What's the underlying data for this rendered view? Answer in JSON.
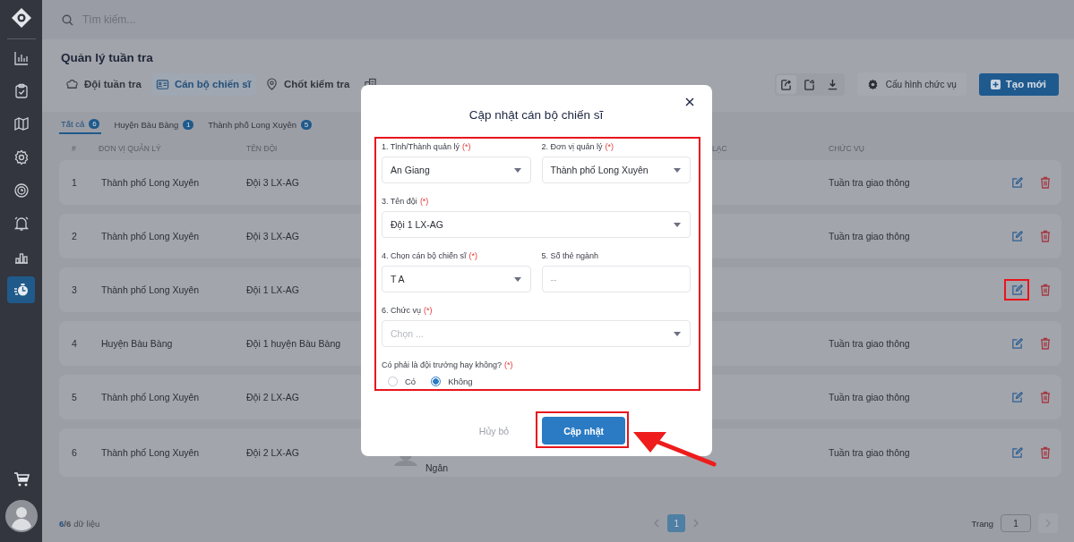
{
  "sidebar": {
    "items": [
      {
        "kind": "chart",
        "selected": false
      },
      {
        "kind": "clipboard",
        "selected": false
      },
      {
        "kind": "map",
        "selected": false
      },
      {
        "kind": "gear",
        "selected": false
      },
      {
        "kind": "timer",
        "selected": false
      },
      {
        "kind": "bell",
        "selected": false
      },
      {
        "kind": "bars",
        "selected": false
      },
      {
        "kind": "stopwatch",
        "selected": true
      }
    ]
  },
  "search": {
    "placeholder": "Tìm kiếm..."
  },
  "page_title": "Quản lý tuần tra",
  "tabs": [
    {
      "label": "Đội tuần tra",
      "kind": "hat",
      "selected": false
    },
    {
      "label": "Cán bộ chiến sĩ",
      "kind": "idcard",
      "selected": true
    },
    {
      "label": "Chốt kiểm tra",
      "kind": "pin",
      "selected": false
    },
    {
      "kind": "building",
      "selected": false
    }
  ],
  "toolbar": {
    "config_button": "Cấu hình chức vụ",
    "create_button": "Tạo mới"
  },
  "filters": [
    {
      "label": "Tất cả",
      "count": "6",
      "selected": true
    },
    {
      "label": "Huyện Bàu Bàng",
      "count": "1",
      "selected": false
    },
    {
      "label": "Thành phố Long Xuyên",
      "count": "5",
      "selected": false
    }
  ],
  "table": {
    "columns": [
      "#",
      "ĐƠN VỊ QUẢN LÝ",
      "TÊN ĐỘI",
      "LẠC",
      "CHỨC VỤ"
    ],
    "rows": [
      {
        "index": "1",
        "unit": "Thành phố Long Xuyên",
        "team": "Đội 3 LX-AG",
        "role": "Tuần tra giao thông",
        "edit_highlighted": false
      },
      {
        "index": "2",
        "unit": "Thành phố Long Xuyên",
        "team": "Đội 3 LX-AG",
        "role": "Tuần tra giao thông",
        "edit_highlighted": false
      },
      {
        "index": "3",
        "unit": "Thành phố Long Xuyên",
        "team": "Đội 1 LX-AG",
        "edit_highlighted": true
      },
      {
        "index": "4",
        "unit": "Huyện Bàu Bàng",
        "team": "Đội 1 huyện Bàu Bàng",
        "role": "Tuần tra giao thông",
        "edit_highlighted": false
      },
      {
        "index": "5",
        "unit": "Thành phố Long Xuyên",
        "team": "Đội 2 LX-AG",
        "role": "Tuần tra giao thông",
        "edit_highlighted": false
      },
      {
        "index": "6",
        "unit": "Thành phố Long Xuyên",
        "team": "Đội 2 LX-AG",
        "person": "Ngân",
        "role": "Tuần tra giao thông",
        "edit_highlighted": false
      }
    ]
  },
  "footer": {
    "shown": "6",
    "total": "/6",
    "label": "dữ liệu",
    "pages": [
      {
        "label": "1",
        "selected": true
      }
    ],
    "page_label": "Trang",
    "page_value": "1"
  },
  "modal": {
    "title": "Cập nhật cán bộ chiến sĩ",
    "field_rows": [
      [
        {
          "label": "1. Tỉnh/Thành quản lý",
          "mark": "(*)",
          "kind": "select",
          "value": "An Giang"
        },
        {
          "label": "2. Đơn vị quản lý",
          "mark": "(*)",
          "kind": "select",
          "value": "Thành phố Long Xuyên"
        }
      ],
      [
        {
          "label": "3. Tên đội",
          "mark": "(*)",
          "kind": "select",
          "value": "Đội 1 LX-AG"
        }
      ],
      [
        {
          "label": "4. Chọn cán bộ chiến sĩ",
          "mark": "(*)",
          "kind": "select",
          "value": "T A"
        },
        {
          "label": "5. Số thẻ ngành",
          "kind": "text",
          "placeholder": "--"
        }
      ],
      [
        {
          "label": "6. Chức vụ",
          "mark": "(*)",
          "kind": "select",
          "placeholder": "Chọn ..."
        }
      ]
    ],
    "question": {
      "label": "Có phải là đội trưởng hay không?",
      "mark": "(*)",
      "options": [
        {
          "label": "Có",
          "selected": false
        },
        {
          "label": "Không",
          "selected": true
        }
      ]
    },
    "cancel_button": "Hủy bỏ",
    "submit_button": "Cập nhật"
  }
}
